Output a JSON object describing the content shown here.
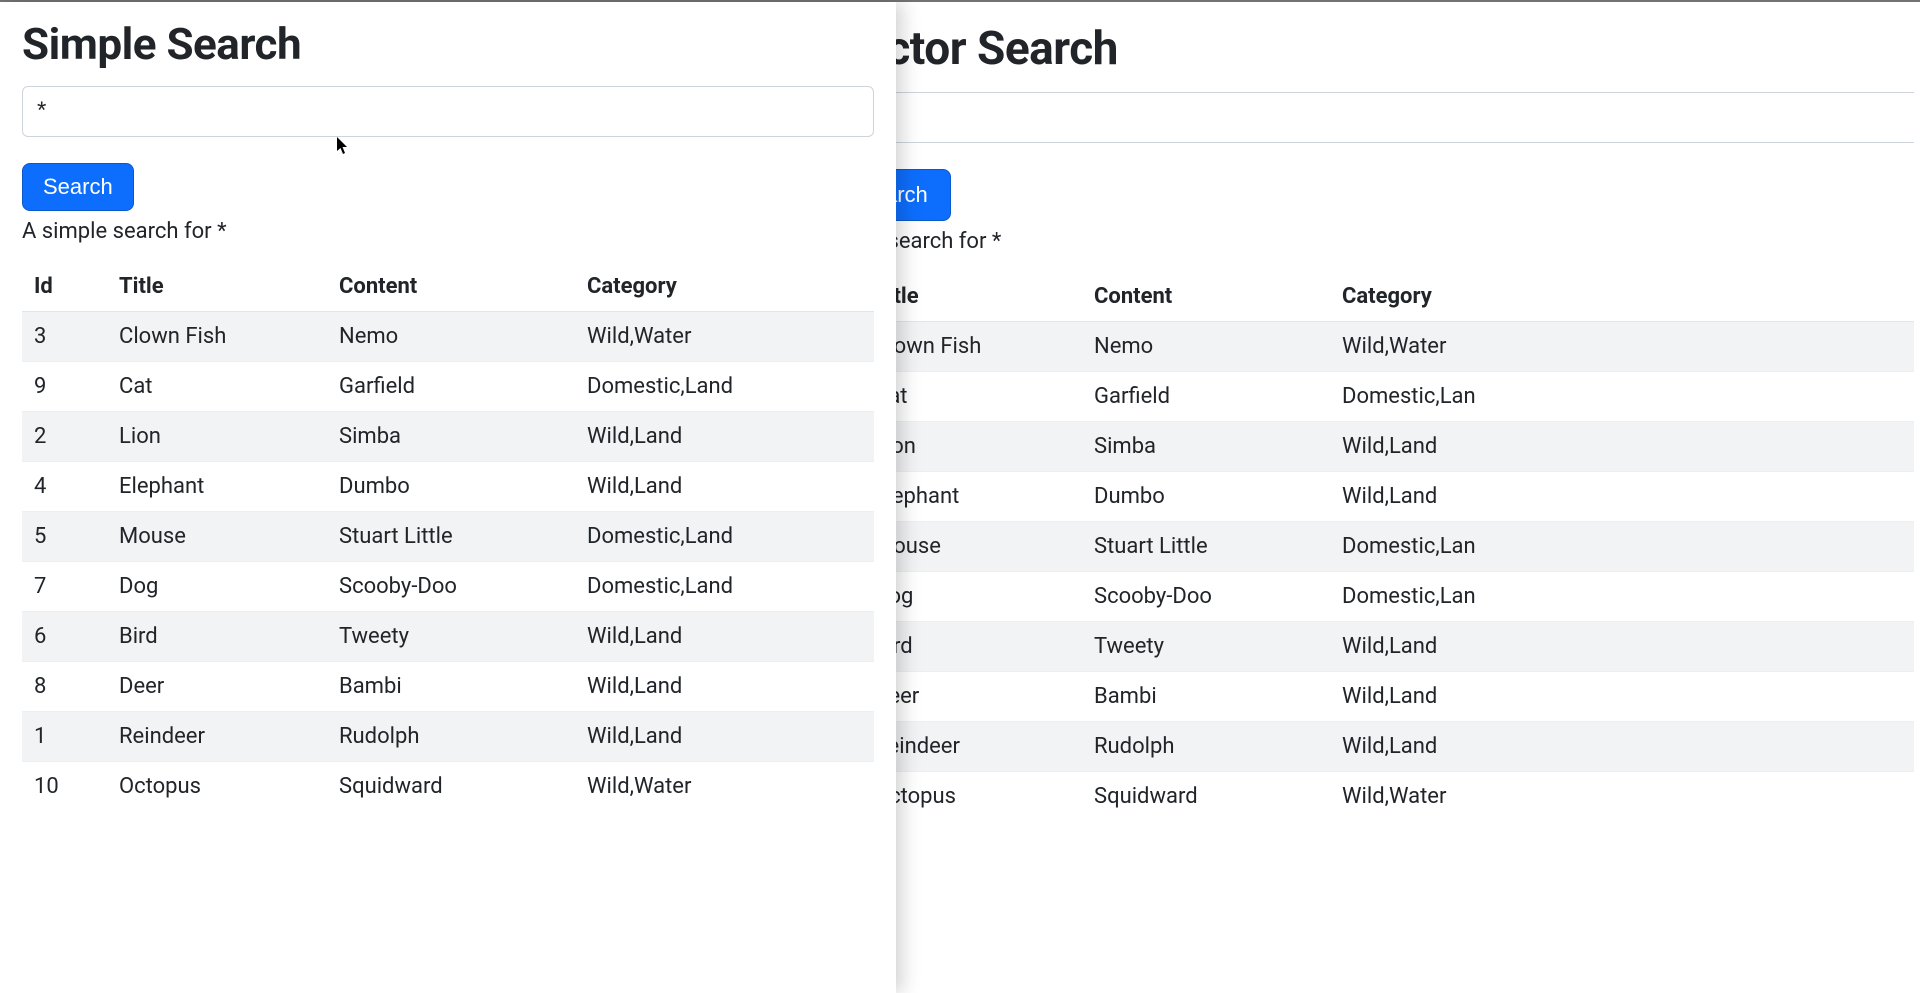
{
  "left": {
    "title": "Simple Search",
    "search_value": "*",
    "search_button": "Search",
    "status": "A simple search for *",
    "columns": {
      "id": "Id",
      "title": "Title",
      "content": "Content",
      "category": "Category"
    },
    "rows": [
      {
        "id": "3",
        "title": "Clown Fish",
        "content": "Nemo",
        "category": "Wild,Water"
      },
      {
        "id": "9",
        "title": "Cat",
        "content": "Garfield",
        "category": "Domestic,Land"
      },
      {
        "id": "2",
        "title": "Lion",
        "content": "Simba",
        "category": "Wild,Land"
      },
      {
        "id": "4",
        "title": "Elephant",
        "content": "Dumbo",
        "category": "Wild,Land"
      },
      {
        "id": "5",
        "title": "Mouse",
        "content": "Stuart Little",
        "category": "Domestic,Land"
      },
      {
        "id": "7",
        "title": "Dog",
        "content": "Scooby-Doo",
        "category": "Domestic,Land"
      },
      {
        "id": "6",
        "title": "Bird",
        "content": "Tweety",
        "category": "Wild,Land"
      },
      {
        "id": "8",
        "title": "Deer",
        "content": "Bambi",
        "category": "Wild,Land"
      },
      {
        "id": "1",
        "title": "Reindeer",
        "content": "Rudolph",
        "category": "Wild,Land"
      },
      {
        "id": "10",
        "title": "Octopus",
        "content": "Squidward",
        "category": "Wild,Water"
      }
    ]
  },
  "right": {
    "title": "ector Search",
    "search_value": "",
    "search_button": "arch",
    "status": "or search for *",
    "columns": {
      "title": "Title",
      "content": "Content",
      "category": "Category"
    },
    "rows": [
      {
        "title": "Clown Fish",
        "content": "Nemo",
        "category": "Wild,Water"
      },
      {
        "title": "Cat",
        "content": "Garfield",
        "category": "Domestic,Lan"
      },
      {
        "title": "Lion",
        "content": "Simba",
        "category": "Wild,Land"
      },
      {
        "title": "Elephant",
        "content": "Dumbo",
        "category": "Wild,Land"
      },
      {
        "title": "Mouse",
        "content": "Stuart Little",
        "category": "Domestic,Lan"
      },
      {
        "title": "Dog",
        "content": "Scooby-Doo",
        "category": "Domestic,Lan"
      },
      {
        "title": "Bird",
        "content": "Tweety",
        "category": "Wild,Land"
      },
      {
        "title": "Deer",
        "content": "Bambi",
        "category": "Wild,Land"
      },
      {
        "title": "Reindeer",
        "content": "Rudolph",
        "category": "Wild,Land"
      },
      {
        "title": "Octopus",
        "content": "Squidward",
        "category": "Wild,Water"
      }
    ]
  }
}
